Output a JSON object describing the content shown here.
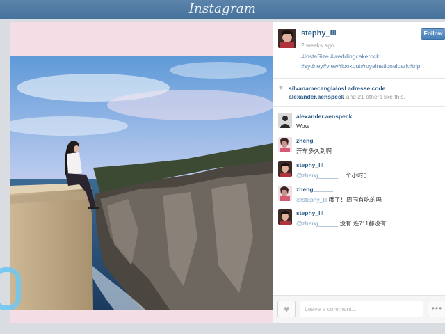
{
  "header": {
    "logo": "Instagram"
  },
  "post": {
    "owner": "stephy_lll",
    "time_ago": "2 weeks ago",
    "caption_line1": "#InstaSize #weddingcakerock",
    "caption_line2": "#sydney#view#lookout#royalnationalpark#trip",
    "follow_label": "Follow"
  },
  "likes": {
    "name1": "silvanamecanglalosl",
    "name2": "adresse.code",
    "name3": "alexander.aenspeck",
    "connector": "and",
    "count": "21",
    "suffix": "others like this."
  },
  "comments": [
    {
      "user": "alexander.aenspeck",
      "text": "Wow"
    },
    {
      "user": "zheng______",
      "text": "开车多久到啊"
    },
    {
      "user": "stephy_lll",
      "mention": "@zheng______",
      "text": "一个小时▯"
    },
    {
      "user": "zheng______",
      "mention": "@stephy_lll",
      "text": "哦了！周围有吃的吗"
    },
    {
      "user": "stephy_lll",
      "mention": "@zheng______",
      "text": "没有 连711都没有"
    }
  ],
  "comment_input": {
    "placeholder": "Leave a comment..."
  },
  "icons": {
    "heart": "heart-icon",
    "more": "more-options-icon"
  },
  "colors": {
    "header": "#4f7aa3",
    "username": "#2c5b86",
    "hashtag": "#5b84ac",
    "follow_button": "#5a8fc4"
  }
}
